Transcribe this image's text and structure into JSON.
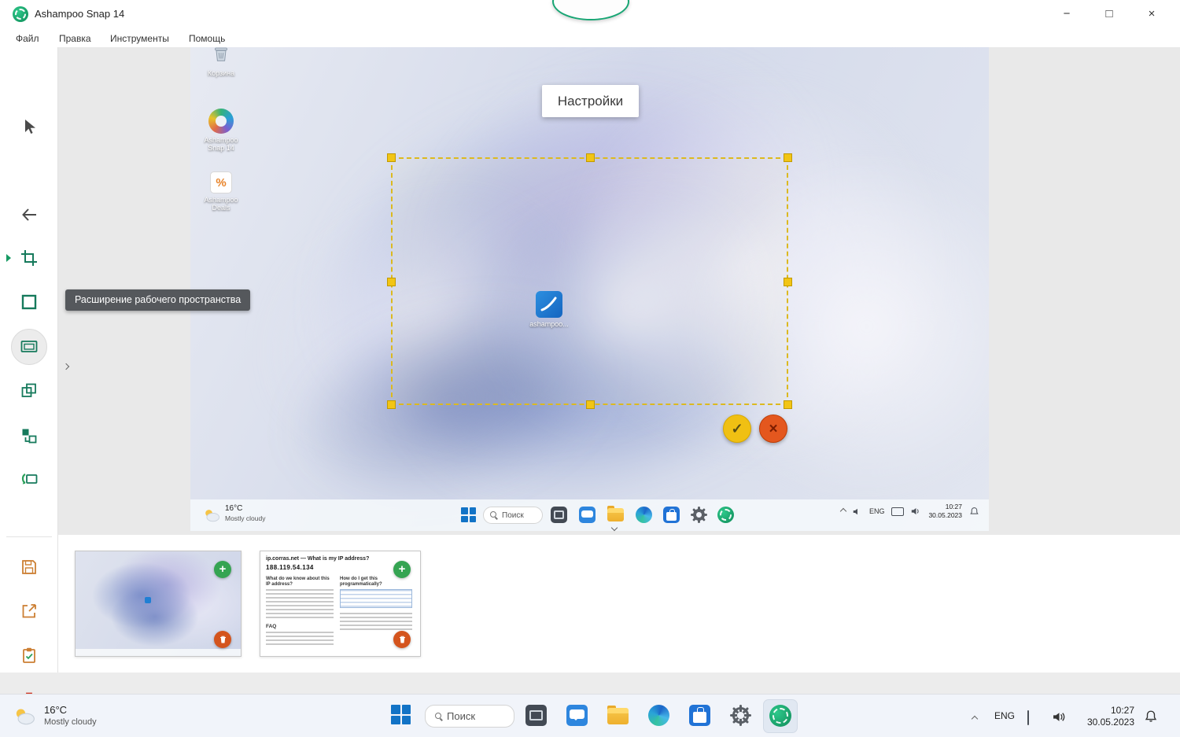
{
  "titlebar": {
    "title": "Ashampoo Snap 14",
    "minimize": "−",
    "maximize": "□",
    "close": "×"
  },
  "menubar": {
    "items": [
      "Файл",
      "Правка",
      "Инструменты",
      "Помощь"
    ]
  },
  "sidebar": {
    "tooltip": "Расширение рабочего пространства"
  },
  "preview": {
    "settings_label": "Настройки",
    "desktop_icons": [
      {
        "label": "Корзина"
      },
      {
        "label": "Ashampoo Snap 14"
      },
      {
        "label": "Ashampoo Deals",
        "glyph": "%"
      }
    ],
    "selection_file_label": "ashampoo...",
    "confirm_glyph": "✓",
    "cancel_glyph": "×",
    "taskbar": {
      "temp": "16°C",
      "condition": "Mostly cloudy",
      "search": "Поиск",
      "lang": "ENG",
      "time": "10:27",
      "date": "30.05.2023"
    }
  },
  "thumbnails": {
    "add_glyph": "+",
    "webpage": {
      "title": "ip.corras.net — What is my IP address?",
      "ip": "188.119.54.134",
      "left_heading": "What do we know about this IP address?",
      "right_heading": "How do I get this programmatically?",
      "faq": "FAQ"
    }
  },
  "taskbar": {
    "temp": "16°C",
    "condition": "Mostly cloudy",
    "search": "Поиск",
    "lang": "ENG",
    "time": "10:27",
    "date": "30.05.2023"
  }
}
